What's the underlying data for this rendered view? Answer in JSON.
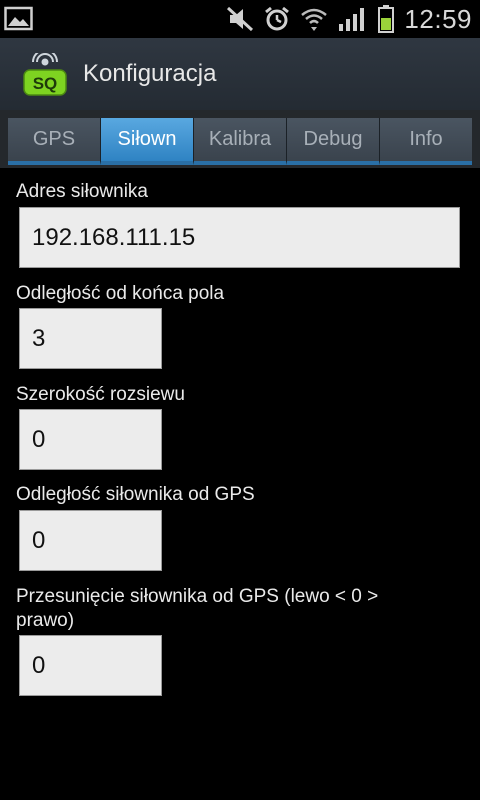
{
  "status_bar": {
    "time": "12:59",
    "icons": [
      "image-icon",
      "mute-icon",
      "alarm-icon",
      "wifi-icon",
      "signal-icon",
      "battery-icon"
    ]
  },
  "action_bar": {
    "title": "Konfiguracja",
    "logo_text": "SQ"
  },
  "tabs": [
    {
      "label": "GPS",
      "active": false
    },
    {
      "label": "Siłown",
      "active": true
    },
    {
      "label": "Kalibra",
      "active": false
    },
    {
      "label": "Debug",
      "active": false
    },
    {
      "label": "Info",
      "active": false
    }
  ],
  "form": {
    "address": {
      "label": "Adres siłownika",
      "value": "192.168.111.15"
    },
    "distance_end": {
      "label": "Odległość od końca pola",
      "value": "3"
    },
    "spread_width": {
      "label": "Szerokość rozsiewu",
      "value": "0"
    },
    "gps_distance": {
      "label": "Odległość siłownika od GPS",
      "value": "0"
    },
    "gps_offset": {
      "label": "Przesunięcie siłownika od GPS (lewo < 0 > prawo)",
      "value": "0"
    }
  },
  "colors": {
    "accent": "#2f83c3",
    "logo_green": "#7ed321"
  }
}
